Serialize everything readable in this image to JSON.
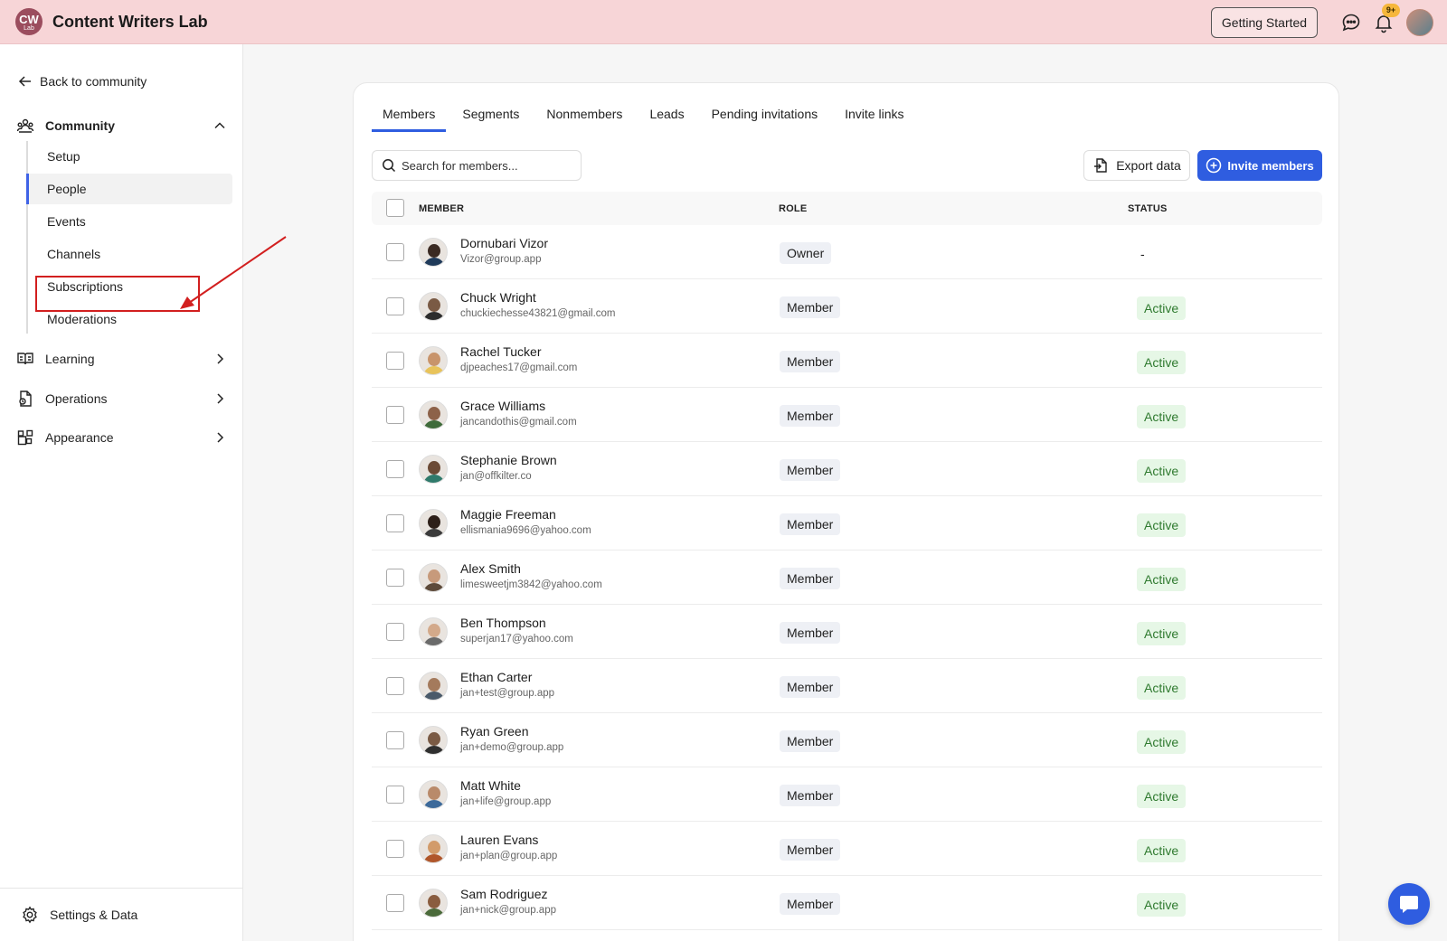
{
  "app": {
    "logo_top": "CW",
    "logo_bottom": "Lab",
    "title": "Content Writers Lab"
  },
  "header": {
    "getting_started": "Getting Started",
    "notification_badge": "9+"
  },
  "sidebar": {
    "back_label": "Back to community",
    "community_label": "Community",
    "items": [
      {
        "label": "Setup"
      },
      {
        "label": "People"
      },
      {
        "label": "Events"
      },
      {
        "label": "Channels"
      },
      {
        "label": "Subscriptions"
      },
      {
        "label": "Moderations"
      }
    ],
    "learning_label": "Learning",
    "operations_label": "Operations",
    "appearance_label": "Appearance",
    "settings_label": "Settings & Data"
  },
  "tabs": [
    "Members",
    "Segments",
    "Nonmembers",
    "Leads",
    "Pending invitations",
    "Invite links"
  ],
  "search": {
    "placeholder": "Search for members..."
  },
  "actions": {
    "export": "Export data",
    "invite": "Invite members"
  },
  "table": {
    "headers": {
      "member": "MEMBER",
      "role": "ROLE",
      "status": "STATUS"
    },
    "rows": [
      {
        "name": "Dornubari Vizor",
        "email": "Vizor@group.app",
        "role": "Owner",
        "status": "-"
      },
      {
        "name": "Chuck Wright",
        "email": "chuckiechesse43821@gmail.com",
        "role": "Member",
        "status": "Active"
      },
      {
        "name": "Rachel Tucker",
        "email": "djpeaches17@gmail.com",
        "role": "Member",
        "status": "Active"
      },
      {
        "name": "Grace Williams",
        "email": "jancandothis@gmail.com",
        "role": "Member",
        "status": "Active"
      },
      {
        "name": "Stephanie Brown",
        "email": "jan@offkilter.co",
        "role": "Member",
        "status": "Active"
      },
      {
        "name": "Maggie Freeman",
        "email": "ellismania9696@yahoo.com",
        "role": "Member",
        "status": "Active"
      },
      {
        "name": "Alex Smith",
        "email": "limesweetjm3842@yahoo.com",
        "role": "Member",
        "status": "Active"
      },
      {
        "name": "Ben Thompson",
        "email": "superjan17@yahoo.com",
        "role": "Member",
        "status": "Active"
      },
      {
        "name": "Ethan Carter",
        "email": "jan+test@group.app",
        "role": "Member",
        "status": "Active"
      },
      {
        "name": "Ryan Green",
        "email": "jan+demo@group.app",
        "role": "Member",
        "status": "Active"
      },
      {
        "name": "Matt White",
        "email": "jan+life@group.app",
        "role": "Member",
        "status": "Active"
      },
      {
        "name": "Lauren Evans",
        "email": "jan+plan@group.app",
        "role": "Member",
        "status": "Active"
      },
      {
        "name": "Sam Rodriguez",
        "email": "jan+nick@group.app",
        "role": "Member",
        "status": "Active"
      }
    ]
  },
  "colors": {
    "accent": "#2f5de0",
    "header_bg": "#f7d5d7",
    "annotation": "#d21f1f"
  }
}
